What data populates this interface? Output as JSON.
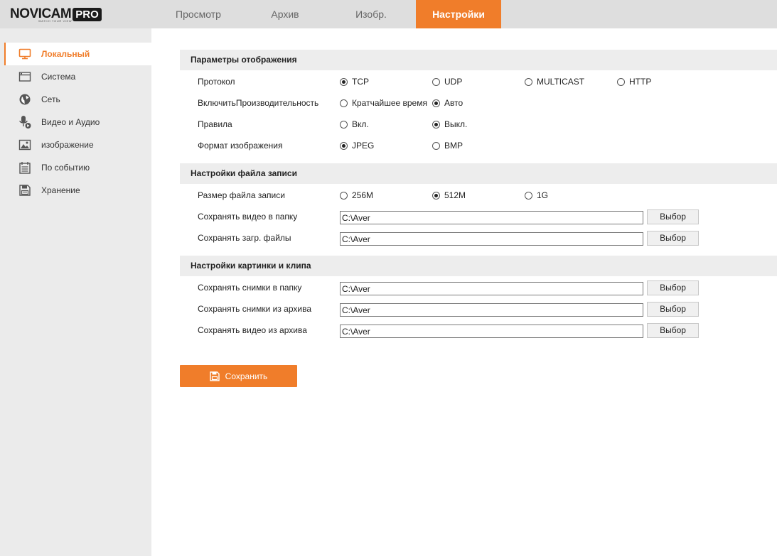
{
  "brand": {
    "logo_main": "NOVICAM",
    "logo_tag": "WATCH YOUR VIEW",
    "logo_pro": "PRO"
  },
  "accent_color": "#f07d2a",
  "nav": {
    "tabs": [
      {
        "label": "Просмотр"
      },
      {
        "label": "Архив"
      },
      {
        "label": "Изобр."
      },
      {
        "label": "Настройки",
        "active": true
      }
    ]
  },
  "sidebar": {
    "items": [
      {
        "label": "Локальный",
        "icon": "monitor-icon",
        "active": true
      },
      {
        "label": "Система",
        "icon": "window-icon"
      },
      {
        "label": "Сеть",
        "icon": "globe-icon"
      },
      {
        "label": "Видео и Аудио",
        "icon": "microphone-icon"
      },
      {
        "label": "изображение",
        "icon": "image-icon"
      },
      {
        "label": "По событию",
        "icon": "calendar-icon"
      },
      {
        "label": "Хранение",
        "icon": "storage-icon"
      }
    ]
  },
  "display_params": {
    "title": "Параметры отображения",
    "protocol": {
      "label": "Протокол",
      "options": [
        "TCP",
        "UDP",
        "MULTICAST",
        "HTTP"
      ],
      "selected": "TCP"
    },
    "performance": {
      "label": "ВключитьПроизводительность",
      "options": [
        "Кратчайшее время",
        "Авто"
      ],
      "selected": "Авто"
    },
    "rules": {
      "label": "Правила",
      "options": [
        "Вкл.",
        "Выкл."
      ],
      "selected": "Выкл."
    },
    "image_format": {
      "label": "Формат изображения",
      "options": [
        "JPEG",
        "BMP"
      ],
      "selected": "JPEG"
    }
  },
  "record_file": {
    "title": "Настройки файла записи",
    "file_size": {
      "label": "Размер файла записи",
      "options": [
        "256M",
        "512M",
        "1G"
      ],
      "selected": "512M"
    },
    "save_video_folder": {
      "label": "Сохранять видео в папку",
      "value": "C:\\Aver"
    },
    "save_download_files": {
      "label": "Сохранять загр. файлы",
      "value": "C:\\Aver"
    }
  },
  "picture_clip": {
    "title": "Настройки картинки и клипа",
    "save_snapshots_folder": {
      "label": "Сохранять снимки в папку",
      "value": "C:\\Aver"
    },
    "save_snapshots_archive": {
      "label": "Сохранять снимки из архива",
      "value": "C:\\Aver"
    },
    "save_video_archive": {
      "label": "Сохранять видео из архива",
      "value": "C:\\Aver"
    }
  },
  "browse_label": "Выбор",
  "save_label": "Сохранить"
}
